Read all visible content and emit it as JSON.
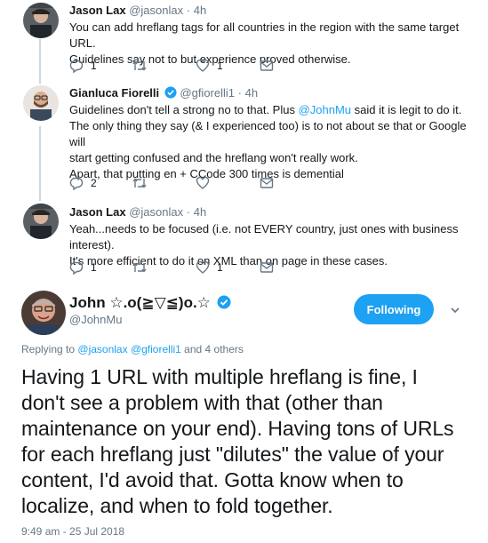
{
  "replies": [
    {
      "name": "Jason Lax",
      "handle": "@jasonlax",
      "time": "4h",
      "lines": [
        "You can add hreflang tags for all countries in the region with the same target URL.",
        "Guidelines say not to but experience proved otherwise."
      ],
      "reply_count": "1",
      "retweet_count": "",
      "like_count": "1"
    },
    {
      "name": "Gianluca Fiorelli",
      "handle": "@gfiorelli1",
      "time": "4h",
      "line1_pre": "Guidelines don't tell a strong no to that. Plus ",
      "line1_mention": "@JohnMu",
      "line1_post": " said it is legit to do it.",
      "lines_rest": [
        "The only thing they say (& I experienced too) is to not about se that or Google will",
        "start getting confused and the hreflang won't really work.",
        "Apart, that putting en + CCode 300 times is demential"
      ],
      "reply_count": "2",
      "retweet_count": "",
      "like_count": ""
    },
    {
      "name": "Jason Lax",
      "handle": "@jasonlax",
      "time": "4h",
      "lines": [
        "Yeah...needs to be focused (i.e. not EVERY country, just ones with business interest).",
        "It's more efficient to do it on XML than on page in these cases."
      ],
      "reply_count": "1",
      "retweet_count": "",
      "like_count": "1"
    }
  ],
  "main_tweet": {
    "name": "John ☆.o(≧▽≦)o.☆",
    "handle": "@JohnMu",
    "follow_label": "Following",
    "replying_prefix": "Replying to",
    "replying_to_1": "@jasonlax",
    "replying_to_2": "@gfiorelli1",
    "replying_suffix": "and 4 others",
    "text": "Having 1 URL with multiple hreflang is fine, I don't see a problem with that (other than maintenance on your end). Having tons of URLs for each hreflang just \"dilutes\" the value of your content, I'd avoid that. Gotta know when to localize, and when to fold together.",
    "timestamp": "9:49 am - 25 Jul 2018"
  },
  "colors": {
    "accent": "#1da1f2",
    "muted": "#657786",
    "thread_line": "#ccd6dd",
    "verified": "#1da1f2"
  },
  "icons": [
    "reply-icon",
    "retweet-icon",
    "like-icon",
    "direct-message-icon",
    "verified-badge-icon",
    "chevron-down-icon"
  ]
}
